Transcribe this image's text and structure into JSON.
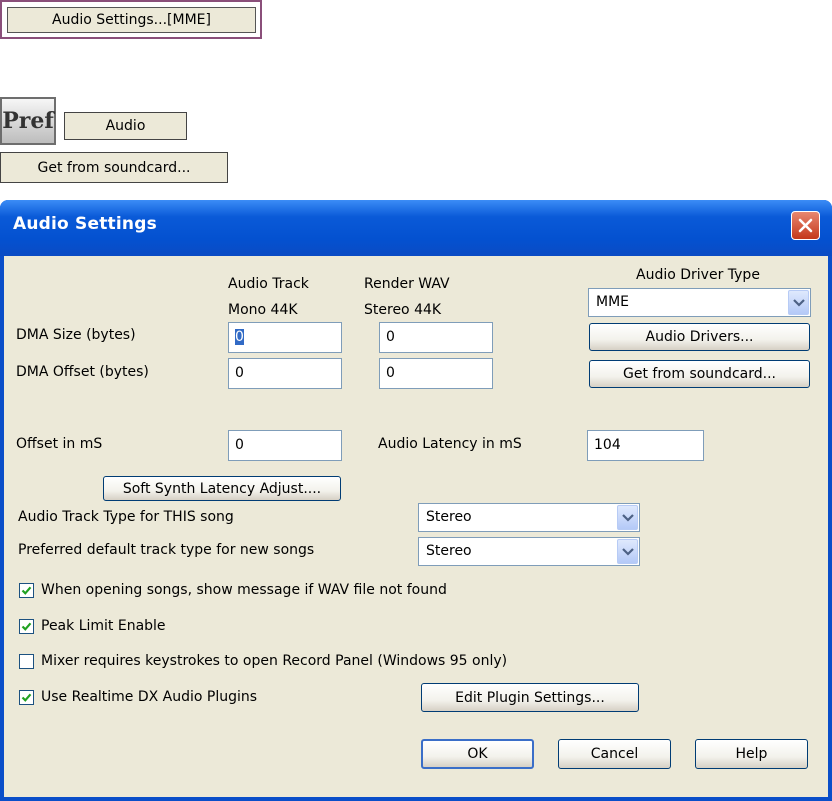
{
  "top_button": {
    "label": "Audio Settings...[MME]"
  },
  "pref_icon": {
    "label": "Pref"
  },
  "audio_button": {
    "label": "Audio"
  },
  "get_soundcard_button": {
    "label": "Get from soundcard..."
  },
  "dialog": {
    "title": "Audio Settings",
    "columns": {
      "audio_track_line1": "Audio Track",
      "audio_track_line2": "Mono 44K",
      "render_wav_line1": "Render WAV",
      "render_wav_line2": "Stereo 44K"
    },
    "dma_size": {
      "label": "DMA Size (bytes)",
      "audio_track": "0",
      "render_wav": "0"
    },
    "dma_offset": {
      "label": "DMA Offset (bytes)",
      "audio_track": "0",
      "render_wav": "0"
    },
    "offset_ms": {
      "label": "Offset in mS",
      "value": "0"
    },
    "audio_latency": {
      "label": "Audio Latency in mS",
      "value": "104"
    },
    "driver_type": {
      "label": "Audio Driver Type",
      "value": "MME"
    },
    "audio_drivers_button": "Audio Drivers...",
    "get_from_soundcard_button": "Get from soundcard...",
    "soft_synth_button": "Soft Synth Latency Adjust....",
    "track_type_this_song": {
      "label": "Audio Track Type for THIS song",
      "value": "Stereo"
    },
    "preferred_track_type": {
      "label": "Preferred default track type for new songs",
      "value": "Stereo"
    },
    "checkboxes": [
      {
        "label": "When opening songs, show message if WAV file not found",
        "checked": true
      },
      {
        "label": "Peak Limit Enable",
        "checked": true
      },
      {
        "label": "Mixer requires keystrokes to open Record Panel (Windows 95 only)",
        "checked": false
      },
      {
        "label": "Use Realtime DX Audio Plugins",
        "checked": true
      }
    ],
    "edit_plugin_button": "Edit Plugin Settings...",
    "ok_button": "OK",
    "cancel_button": "Cancel",
    "help_button": "Help"
  },
  "colors": {
    "titlebar": "#0a5ad8",
    "client_bg": "#ece9d8",
    "close_button": "#c4381b",
    "check": "#21a121"
  }
}
